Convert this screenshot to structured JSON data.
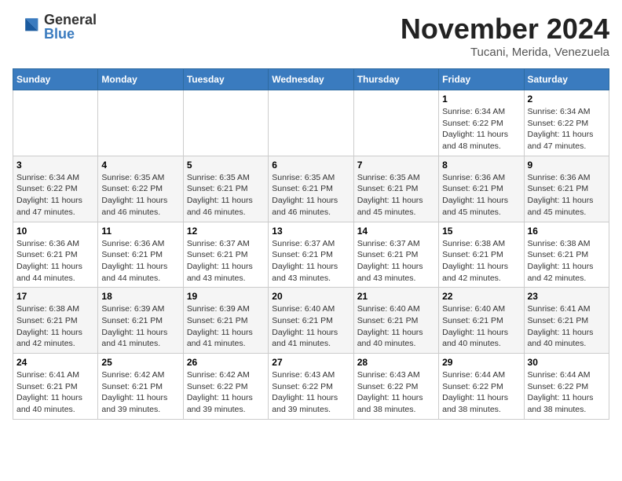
{
  "logo": {
    "general": "General",
    "blue": "Blue"
  },
  "header": {
    "month": "November 2024",
    "location": "Tucani, Merida, Venezuela"
  },
  "weekdays": [
    "Sunday",
    "Monday",
    "Tuesday",
    "Wednesday",
    "Thursday",
    "Friday",
    "Saturday"
  ],
  "weeks": [
    [
      {
        "day": "",
        "info": ""
      },
      {
        "day": "",
        "info": ""
      },
      {
        "day": "",
        "info": ""
      },
      {
        "day": "",
        "info": ""
      },
      {
        "day": "",
        "info": ""
      },
      {
        "day": "1",
        "info": "Sunrise: 6:34 AM\nSunset: 6:22 PM\nDaylight: 11 hours and 48 minutes."
      },
      {
        "day": "2",
        "info": "Sunrise: 6:34 AM\nSunset: 6:22 PM\nDaylight: 11 hours and 47 minutes."
      }
    ],
    [
      {
        "day": "3",
        "info": "Sunrise: 6:34 AM\nSunset: 6:22 PM\nDaylight: 11 hours and 47 minutes."
      },
      {
        "day": "4",
        "info": "Sunrise: 6:35 AM\nSunset: 6:22 PM\nDaylight: 11 hours and 46 minutes."
      },
      {
        "day": "5",
        "info": "Sunrise: 6:35 AM\nSunset: 6:21 PM\nDaylight: 11 hours and 46 minutes."
      },
      {
        "day": "6",
        "info": "Sunrise: 6:35 AM\nSunset: 6:21 PM\nDaylight: 11 hours and 46 minutes."
      },
      {
        "day": "7",
        "info": "Sunrise: 6:35 AM\nSunset: 6:21 PM\nDaylight: 11 hours and 45 minutes."
      },
      {
        "day": "8",
        "info": "Sunrise: 6:36 AM\nSunset: 6:21 PM\nDaylight: 11 hours and 45 minutes."
      },
      {
        "day": "9",
        "info": "Sunrise: 6:36 AM\nSunset: 6:21 PM\nDaylight: 11 hours and 45 minutes."
      }
    ],
    [
      {
        "day": "10",
        "info": "Sunrise: 6:36 AM\nSunset: 6:21 PM\nDaylight: 11 hours and 44 minutes."
      },
      {
        "day": "11",
        "info": "Sunrise: 6:36 AM\nSunset: 6:21 PM\nDaylight: 11 hours and 44 minutes."
      },
      {
        "day": "12",
        "info": "Sunrise: 6:37 AM\nSunset: 6:21 PM\nDaylight: 11 hours and 43 minutes."
      },
      {
        "day": "13",
        "info": "Sunrise: 6:37 AM\nSunset: 6:21 PM\nDaylight: 11 hours and 43 minutes."
      },
      {
        "day": "14",
        "info": "Sunrise: 6:37 AM\nSunset: 6:21 PM\nDaylight: 11 hours and 43 minutes."
      },
      {
        "day": "15",
        "info": "Sunrise: 6:38 AM\nSunset: 6:21 PM\nDaylight: 11 hours and 42 minutes."
      },
      {
        "day": "16",
        "info": "Sunrise: 6:38 AM\nSunset: 6:21 PM\nDaylight: 11 hours and 42 minutes."
      }
    ],
    [
      {
        "day": "17",
        "info": "Sunrise: 6:38 AM\nSunset: 6:21 PM\nDaylight: 11 hours and 42 minutes."
      },
      {
        "day": "18",
        "info": "Sunrise: 6:39 AM\nSunset: 6:21 PM\nDaylight: 11 hours and 41 minutes."
      },
      {
        "day": "19",
        "info": "Sunrise: 6:39 AM\nSunset: 6:21 PM\nDaylight: 11 hours and 41 minutes."
      },
      {
        "day": "20",
        "info": "Sunrise: 6:40 AM\nSunset: 6:21 PM\nDaylight: 11 hours and 41 minutes."
      },
      {
        "day": "21",
        "info": "Sunrise: 6:40 AM\nSunset: 6:21 PM\nDaylight: 11 hours and 40 minutes."
      },
      {
        "day": "22",
        "info": "Sunrise: 6:40 AM\nSunset: 6:21 PM\nDaylight: 11 hours and 40 minutes."
      },
      {
        "day": "23",
        "info": "Sunrise: 6:41 AM\nSunset: 6:21 PM\nDaylight: 11 hours and 40 minutes."
      }
    ],
    [
      {
        "day": "24",
        "info": "Sunrise: 6:41 AM\nSunset: 6:21 PM\nDaylight: 11 hours and 40 minutes."
      },
      {
        "day": "25",
        "info": "Sunrise: 6:42 AM\nSunset: 6:21 PM\nDaylight: 11 hours and 39 minutes."
      },
      {
        "day": "26",
        "info": "Sunrise: 6:42 AM\nSunset: 6:22 PM\nDaylight: 11 hours and 39 minutes."
      },
      {
        "day": "27",
        "info": "Sunrise: 6:43 AM\nSunset: 6:22 PM\nDaylight: 11 hours and 39 minutes."
      },
      {
        "day": "28",
        "info": "Sunrise: 6:43 AM\nSunset: 6:22 PM\nDaylight: 11 hours and 38 minutes."
      },
      {
        "day": "29",
        "info": "Sunrise: 6:44 AM\nSunset: 6:22 PM\nDaylight: 11 hours and 38 minutes."
      },
      {
        "day": "30",
        "info": "Sunrise: 6:44 AM\nSunset: 6:22 PM\nDaylight: 11 hours and 38 minutes."
      }
    ]
  ]
}
